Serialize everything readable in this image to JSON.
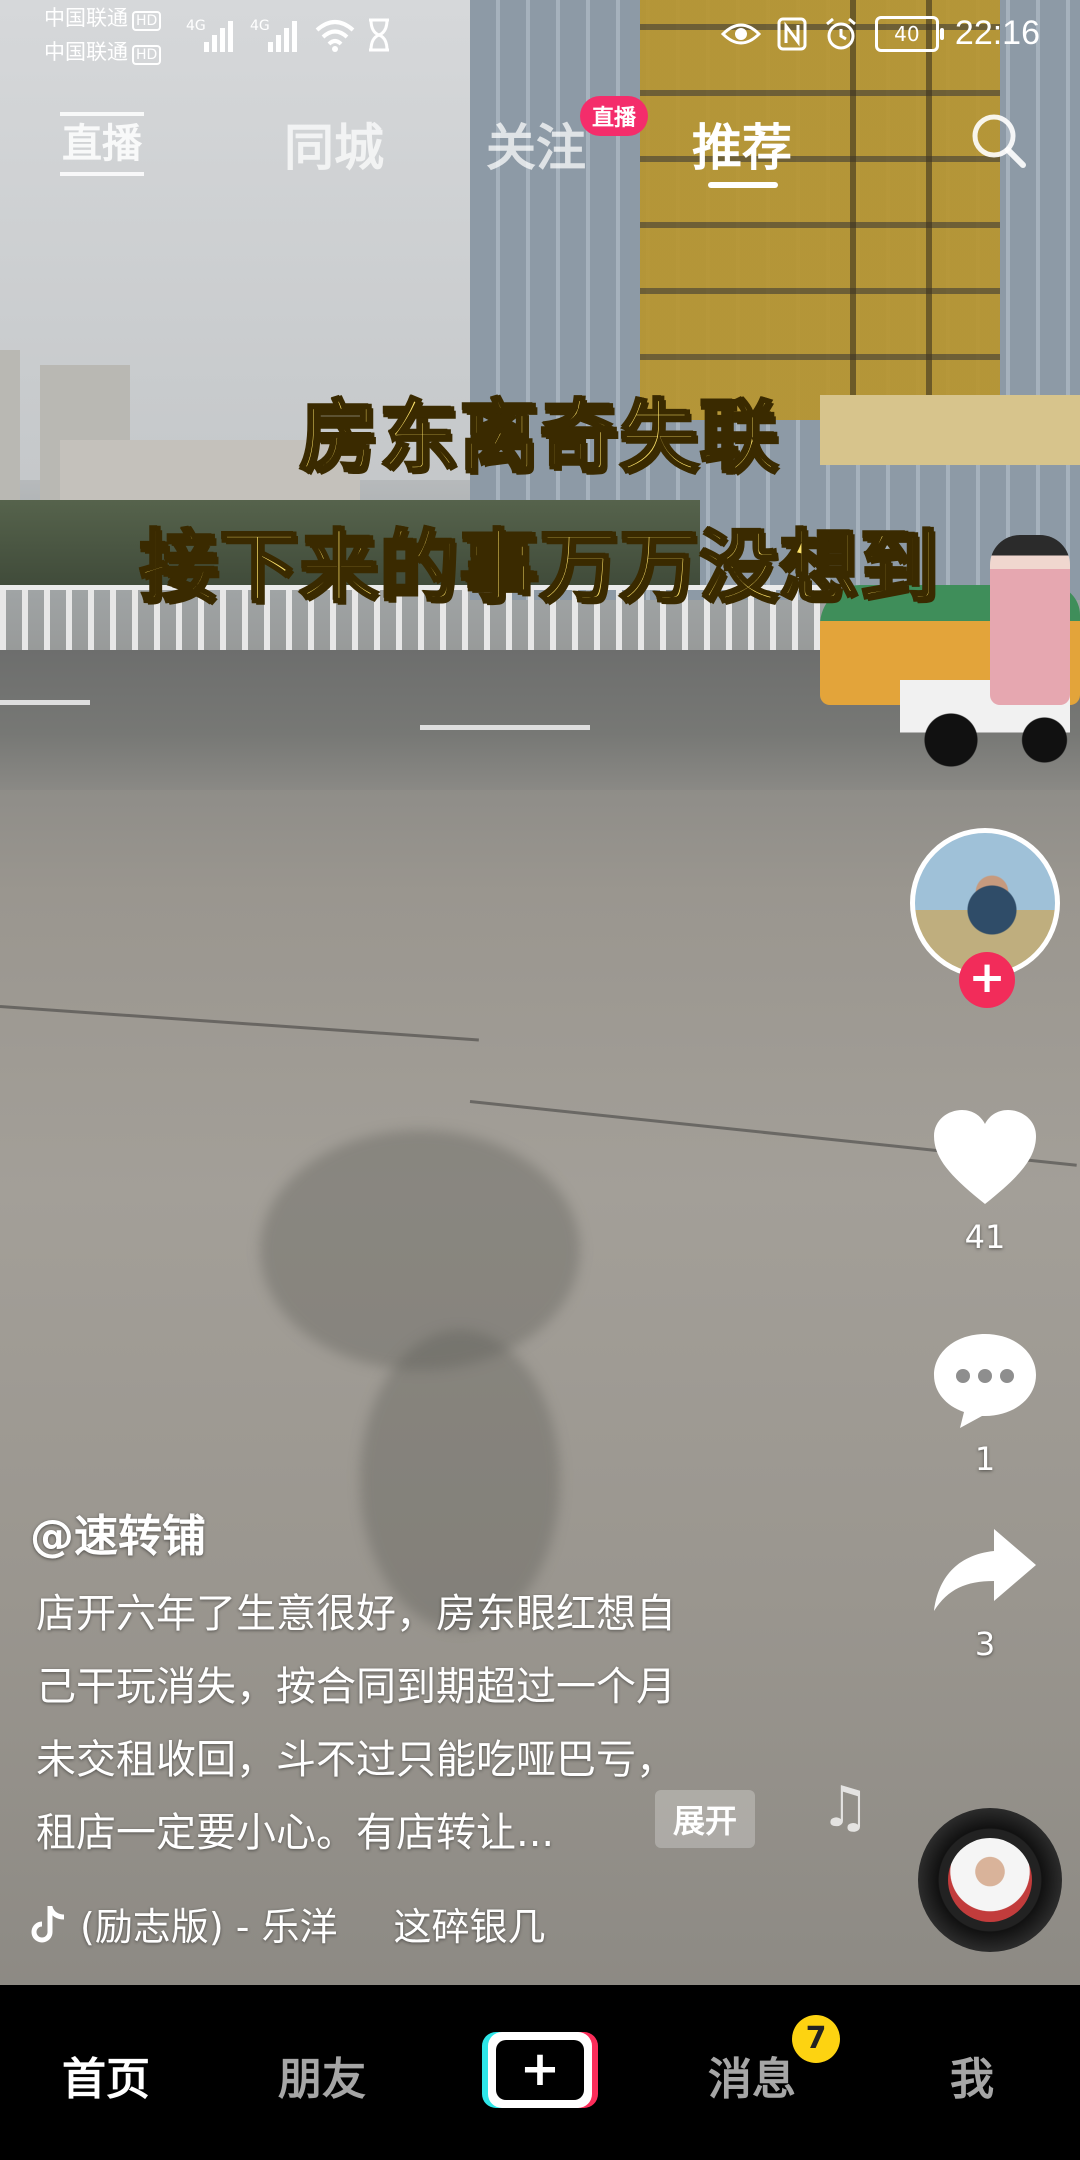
{
  "status_bar": {
    "carrier1": "中国联通",
    "carrier2": "中国联通",
    "hd": "HD",
    "network1": "4G",
    "network2": "4G",
    "battery": "40",
    "time": "22:16"
  },
  "top_nav": {
    "live_entry": "直播",
    "tabs": [
      {
        "label": "同城"
      },
      {
        "label": "关注"
      },
      {
        "label": "推荐"
      }
    ],
    "live_badge": "直播",
    "active_tab": "推荐"
  },
  "video": {
    "caption_line1": "房东离奇失联",
    "caption_line2": "接下来的事万万没想到"
  },
  "actions": {
    "like_count": "41",
    "comment_count": "1",
    "share_count": "3",
    "follow_symbol": "+"
  },
  "post": {
    "username": "@速转铺",
    "description_lines": [
      "店开六年了生意很好，房东眼红想自",
      "己干玩消失，按合同到期超过一个月",
      "未交租收回，斗不过只能吃哑巴亏，",
      "租店一定要小心。有店转让..."
    ],
    "expand_label": "展开",
    "music_title": "(励志版) - 乐洋",
    "music_extra": "这碎银几"
  },
  "tab_bar": {
    "items": [
      {
        "label": "首页"
      },
      {
        "label": "朋友"
      },
      {
        "label": "消息"
      },
      {
        "label": "我"
      }
    ],
    "create_symbol": "+",
    "message_badge": "7"
  },
  "colors": {
    "accent_red": "#f22c5a",
    "live_badge": "#f42d6b",
    "caption_yellow": "#fde36a",
    "badge_yellow": "#fdd311",
    "cyan": "#2ee6e8"
  }
}
